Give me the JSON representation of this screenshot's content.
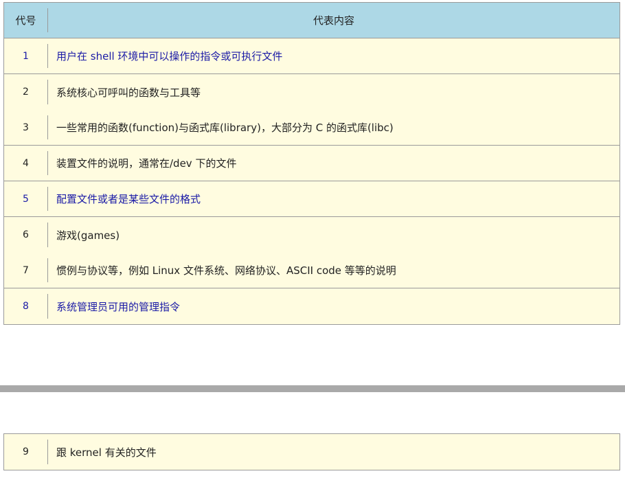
{
  "header": {
    "code_label": "代号",
    "content_label": "代表内容"
  },
  "rows": [
    {
      "code": "1",
      "desc": "用户在 shell 环境中可以操作的指令或可执行文件"
    },
    {
      "code": "2",
      "desc": "系统核心可呼叫的函数与工具等"
    },
    {
      "code": "3",
      "desc": "一些常用的函数(function)与函式库(library)，大部分为 C 的函式库(libc)"
    },
    {
      "code": "4",
      "desc": "装置文件的说明，通常在/dev 下的文件"
    },
    {
      "code": "5",
      "desc": "配置文件或者是某些文件的格式"
    },
    {
      "code": "6",
      "desc": "游戏(games)"
    },
    {
      "code": "7",
      "desc": "惯例与协议等，例如 Linux 文件系统、网络协议、ASCII code 等等的说明"
    },
    {
      "code": "8",
      "desc": "系统管理员可用的管理指令"
    }
  ],
  "extra_rows": [
    {
      "code": "9",
      "desc": "跟 kernel 有关的文件"
    }
  ],
  "colors": {
    "header_bg": "#add8e6",
    "row_bg": "#fffce0",
    "highlight_text": "#1a1aa6",
    "border": "#9a9a9a",
    "divider": "#a9a9a9"
  }
}
